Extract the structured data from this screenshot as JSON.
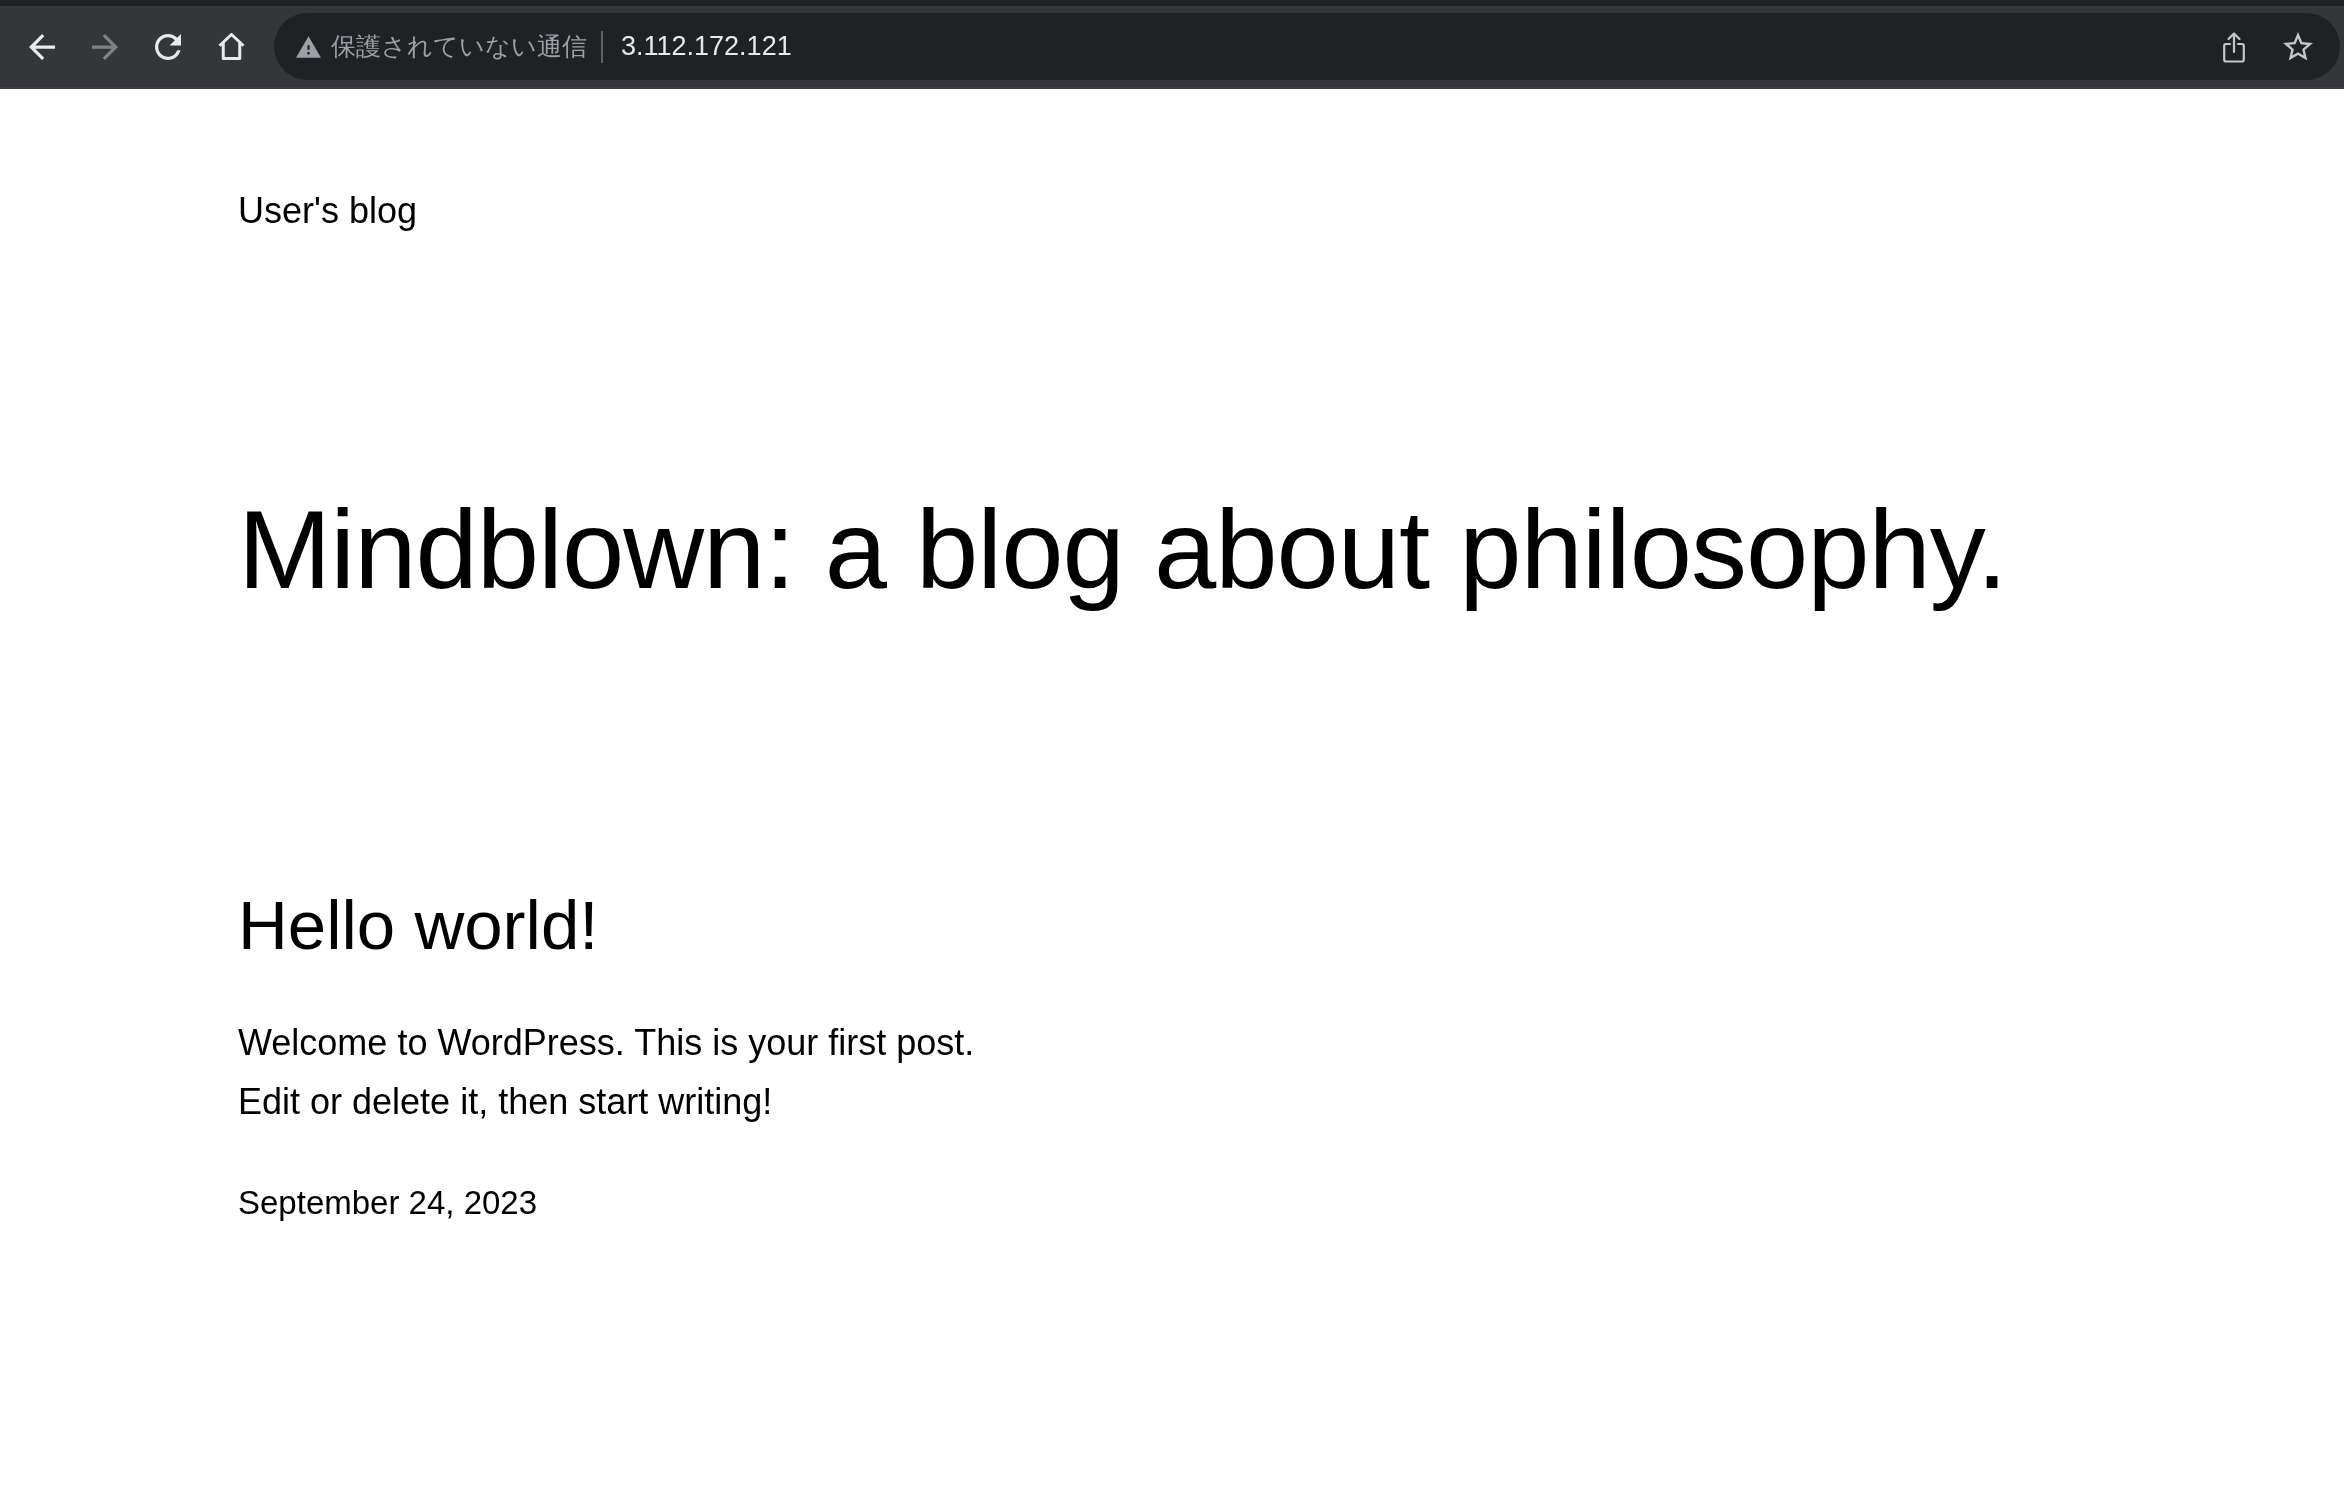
{
  "browser": {
    "nav_buttons": [
      {
        "kind": "back",
        "disabled": false
      },
      {
        "kind": "forward",
        "disabled": true
      },
      {
        "kind": "reload",
        "disabled": false
      },
      {
        "kind": "home",
        "disabled": false
      }
    ],
    "address_bar": {
      "security_label": "保護されていない通信",
      "url": "3.112.172.121"
    },
    "actions": [
      {
        "kind": "share"
      },
      {
        "kind": "bookmark"
      }
    ]
  },
  "page": {
    "site_title": "User's blog",
    "heading": "Mindblown: a blog about philosophy.",
    "posts": [
      {
        "title": "Hello world!",
        "excerpt": "Welcome to WordPress. This is your first post. Edit or delete it, then start writing!",
        "date": "September 24, 2023"
      }
    ]
  }
}
